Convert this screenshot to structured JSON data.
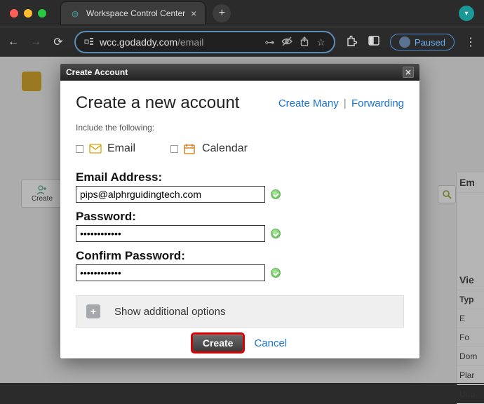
{
  "browser": {
    "tab_title": "Workspace Control Center",
    "url_display": "wcc.godaddy.com",
    "url_path": "/email",
    "paused_label": "Paused"
  },
  "background": {
    "create_btn_label": "Create",
    "right_panel": {
      "em_heading": "Em",
      "view_heading": "Vie",
      "type_label": "Typ",
      "row1": "E",
      "row2": "Fo",
      "row3": "Dom",
      "row4": "Plar",
      "row5": "Unu"
    }
  },
  "modal": {
    "titlebar": "Create Account",
    "heading": "Create a new account",
    "links": {
      "create_many": "Create Many",
      "forwarding": "Forwarding"
    },
    "include_label": "Include the following:",
    "services": {
      "email_label": "Email",
      "calendar_label": "Calendar"
    },
    "fields": {
      "email_label": "Email Address:",
      "email_value": "pips@alphrguidingtech.com",
      "password_label": "Password:",
      "password_value": "••••••••••••",
      "confirm_label": "Confirm Password:",
      "confirm_value": "••••••••••••"
    },
    "expand_label": "Show additional options",
    "buttons": {
      "create": "Create",
      "cancel": "Cancel"
    }
  }
}
